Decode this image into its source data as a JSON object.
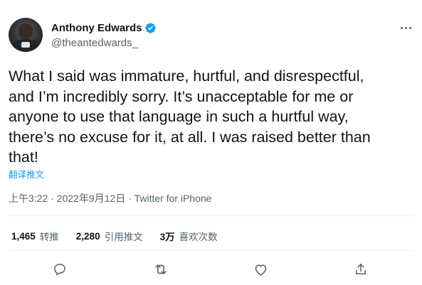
{
  "author": {
    "name": "Anthony Edwards",
    "handle": "@theantedwards_",
    "verified_icon": "verified-badge-icon",
    "accent_color": "#1d9bf0"
  },
  "tweet": {
    "text": "What I said was immature, hurtful, and disrespectful,\nand I’m incredibly sorry. It’s unacceptable for me or\nanyone to use that language in such a hurtful way,\nthere’s no excuse for it, at all. I was raised better than\nthat!",
    "translate_label": "翻译推文",
    "timestamp": "上午3:22 · 2022年9月12日 · ",
    "source": "Twitter for iPhone"
  },
  "stats": {
    "retweets_count": "1,465",
    "retweets_label": "转推",
    "quotes_count": "2,280",
    "quotes_label": "引用推文",
    "likes_count": "3万",
    "likes_label": "喜欢次数"
  },
  "actions": {
    "reply_icon": "reply-icon",
    "retweet_icon": "retweet-icon",
    "like_icon": "like-icon",
    "share_icon": "share-icon",
    "more_icon": "more-icon"
  }
}
